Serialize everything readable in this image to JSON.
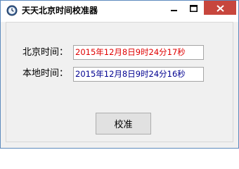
{
  "window": {
    "title": "天天北京时间校准器",
    "controls": {
      "minimize": "minimize-icon",
      "maximize": "maximize-icon",
      "close": "close-icon"
    },
    "accent_color": "#5e8bbe",
    "close_color": "#c7463d"
  },
  "form": {
    "beijing_label": "北京时间：",
    "beijing_value": "2015年12月8日9时24分17秒",
    "beijing_value_color": "#e00000",
    "local_label": "本地时间：",
    "local_value": "2015年12月8日9时24分16秒",
    "local_value_color": "#000090",
    "calibrate_label": "校准"
  }
}
